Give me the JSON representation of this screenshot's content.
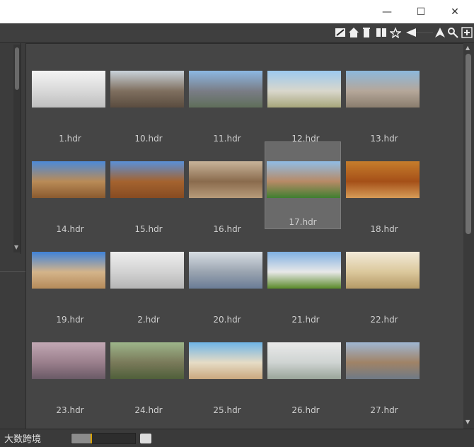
{
  "window": {
    "minimize_icon": "minimize-icon",
    "maximize_icon": "maximize-icon",
    "close_icon": "close-icon",
    "minimize_glyph": "—",
    "maximize_glyph": "☐",
    "close_glyph": "✕"
  },
  "toolbar": {
    "icons": [
      "slash-box-icon",
      "home-icon",
      "bin-icon",
      "book-icon",
      "star-icon",
      "arrow-left-icon",
      "navigate-icon",
      "search-icon",
      "add-box-icon"
    ]
  },
  "grid": {
    "selected": "17.hdr",
    "items": [
      {
        "label": "1.hdr",
        "colors": [
          "#f4f4f4",
          "#d8d8d8",
          "#bfbfbf"
        ]
      },
      {
        "label": "10.hdr",
        "colors": [
          "#c9d2da",
          "#7f6f5f",
          "#5a4c3f"
        ]
      },
      {
        "label": "11.hdr",
        "colors": [
          "#8cb8e3",
          "#7a7d86",
          "#5f6e5a"
        ]
      },
      {
        "label": "12.hdr",
        "colors": [
          "#9cc9ef",
          "#d9d7cc",
          "#a7a67b"
        ]
      },
      {
        "label": "13.hdr",
        "colors": [
          "#8cb8dc",
          "#b5a79a",
          "#8a7d6d"
        ]
      },
      {
        "label": "14.hdr",
        "colors": [
          "#4c8ad8",
          "#b98b57",
          "#8a5a2f"
        ]
      },
      {
        "label": "15.hdr",
        "colors": [
          "#5a90d8",
          "#a4632f",
          "#874b22"
        ]
      },
      {
        "label": "16.hdr",
        "colors": [
          "#c8b49a",
          "#8a6b4d",
          "#b79b7a"
        ]
      },
      {
        "label": "17.hdr",
        "colors": [
          "#90bde6",
          "#b78a66",
          "#3f7f30"
        ]
      },
      {
        "label": "18.hdr",
        "colors": [
          "#c67d2c",
          "#a55018",
          "#d69c58"
        ]
      },
      {
        "label": "19.hdr",
        "colors": [
          "#3f82d8",
          "#d4b48a",
          "#b58b5a"
        ]
      },
      {
        "label": "2.hdr",
        "colors": [
          "#eeeeee",
          "#d2d2d2",
          "#b5b5b5"
        ]
      },
      {
        "label": "20.hdr",
        "colors": [
          "#d7dde3",
          "#9aa4b0",
          "#6a7c96"
        ]
      },
      {
        "label": "21.hdr",
        "colors": [
          "#7fb0e2",
          "#e8e8e8",
          "#5a8a2a"
        ]
      },
      {
        "label": "22.hdr",
        "colors": [
          "#f2ead8",
          "#dbc89c",
          "#b59a66"
        ]
      },
      {
        "label": "23.hdr",
        "colors": [
          "#c2a8b4",
          "#9a7f8c",
          "#6a5a66"
        ]
      },
      {
        "label": "24.hdr",
        "colors": [
          "#9db58a",
          "#7a7a5a",
          "#4f5f3a"
        ]
      },
      {
        "label": "25.hdr",
        "colors": [
          "#6eb4e6",
          "#e6dcc6",
          "#caa87e"
        ]
      },
      {
        "label": "26.hdr",
        "colors": [
          "#e9e9e9",
          "#cfd4d2",
          "#9aa59a"
        ]
      },
      {
        "label": "27.hdr",
        "colors": [
          "#9fb6d2",
          "#a08366",
          "#6f7a86"
        ]
      }
    ]
  },
  "statusbar": {
    "watermark": "大数跨境",
    "progress_fraction": 0.3,
    "user_icon": "user-icon"
  }
}
